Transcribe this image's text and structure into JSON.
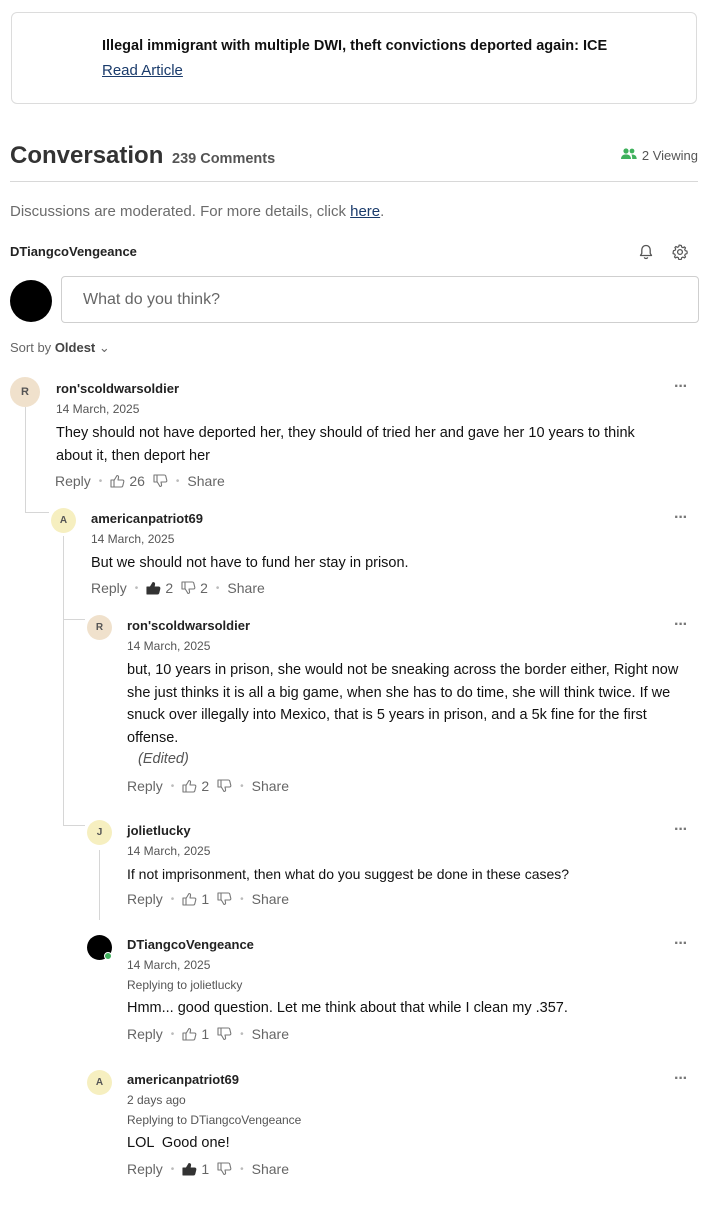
{
  "article": {
    "title": "Illegal immigrant with multiple DWI, theft convictions deported again: ICE",
    "link": "Read Article"
  },
  "conversation": {
    "title": "Conversation",
    "count": "239 Comments",
    "viewing": "2 Viewing"
  },
  "moderation": {
    "text": "Discussions are moderated. For more details, click ",
    "link": "here",
    "end": "."
  },
  "current_user": {
    "name": "DTiangcoVengeance"
  },
  "input": {
    "placeholder": "What do you think?"
  },
  "sort": {
    "label": "Sort by",
    "value": "Oldest"
  },
  "actions": {
    "reply": "Reply",
    "share": "Share",
    "more": "···"
  },
  "comments": [
    {
      "initial": "R",
      "user": "ron'scoldwarsoldier",
      "date": "14 March, 2025",
      "text": "They should not have deported her, they should of tried her and gave her 10 years to think about it, then deport her",
      "likes": "26",
      "dislikes": ""
    },
    {
      "initial": "A",
      "user": "americanpatriot69",
      "date": "14 March, 2025",
      "text": "But we should not have to fund her stay in prison.",
      "likes": "2",
      "dislikes": "2"
    },
    {
      "initial": "R",
      "user": "ron'scoldwarsoldier",
      "date": "14 March, 2025",
      "text": "but, 10 years in prison, she would not be sneaking across the border either, Right now she just thinks it is all a big game, when she has to do time, she will think twice. If we snuck over illegally into Mexico, that is 5 years in prison, and a 5k fine for the first offense.",
      "edited": "(Edited)",
      "likes": "2",
      "dislikes": ""
    },
    {
      "initial": "J",
      "user": "jolietlucky",
      "date": "14 March, 2025",
      "text": "If not imprisonment, then what do you suggest be done in these cases?",
      "likes": "1",
      "dislikes": ""
    },
    {
      "initial": "",
      "user": "DTiangcoVengeance",
      "date": "14 March, 2025",
      "replying": "Replying to jolietlucky",
      "text": "Hmm... good question. Let me think about that while I clean my .357.",
      "likes": "1",
      "dislikes": ""
    },
    {
      "initial": "A",
      "user": "americanpatriot69",
      "date": "2 days ago",
      "replying": "Replying to DTiangcoVengeance",
      "text": "LOL  Good one!",
      "likes": "1",
      "dislikes": ""
    }
  ],
  "colors": {
    "link": "#1a3b6b",
    "online": "#3fb15c",
    "viewing_icon": "#3fb15c"
  },
  "icons": [
    "people-icon",
    "bell-icon",
    "gear-icon",
    "thumbs-up-icon",
    "thumbs-down-icon",
    "chevron-down-icon",
    "more-icon"
  ]
}
